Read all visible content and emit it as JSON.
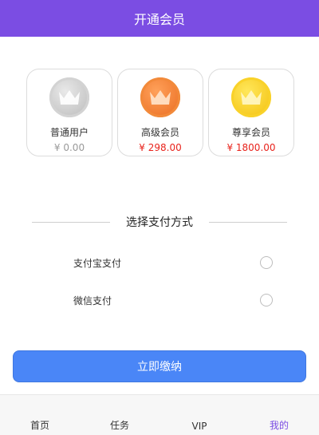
{
  "header": {
    "title": "开通会员"
  },
  "plans": [
    {
      "name": "普通用户",
      "price": "¥ 0.00",
      "icon": "crown-silver-icon"
    },
    {
      "name": "高级会员",
      "price": "¥ 298.00",
      "icon": "crown-orange-icon"
    },
    {
      "name": "尊享会员",
      "price": "¥ 1800.00",
      "icon": "crown-gold-icon"
    }
  ],
  "payment": {
    "title": "选择支付方式",
    "options": [
      {
        "label": "支付宝支付",
        "selected": false
      },
      {
        "label": "微信支付",
        "selected": false
      }
    ]
  },
  "pay_button": {
    "label": "立即缴纳"
  },
  "tabbar": {
    "items": [
      {
        "label": "首页"
      },
      {
        "label": "任务"
      },
      {
        "label": "VIP"
      },
      {
        "label": "我的"
      }
    ],
    "active": "我的"
  },
  "colors": {
    "header_bg": "#7b4de3",
    "price_red": "#e8221b",
    "button_blue": "#4a86f7",
    "tab_active": "#7b4de3"
  }
}
